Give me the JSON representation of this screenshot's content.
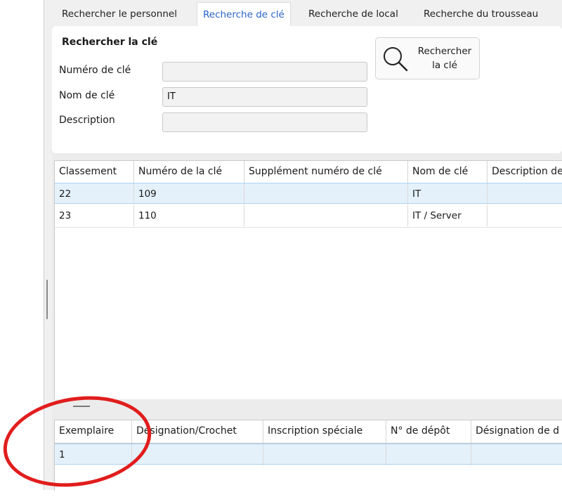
{
  "tabs": [
    {
      "label": "Rechercher le personnel",
      "active": false
    },
    {
      "label": "Recherche de clé",
      "active": true
    },
    {
      "label": "Recherche de local",
      "active": false
    },
    {
      "label": "Recherche du trousseau",
      "active": false
    }
  ],
  "search": {
    "title": "Rechercher la clé",
    "fields": [
      {
        "label": "Numéro de clé",
        "value": ""
      },
      {
        "label": "Nom de clé",
        "value": "IT"
      },
      {
        "label": "Description",
        "value": ""
      }
    ],
    "button_label": "Rechercher\nla clé",
    "button_icon": "search-icon"
  },
  "keys_table": {
    "columns": [
      "Classement",
      "Numéro de la clé",
      "Supplément numéro de clé",
      "Nom de clé",
      "Description de"
    ],
    "rows": [
      [
        "22",
        "109",
        "",
        "IT",
        ""
      ],
      [
        "23",
        "110",
        "",
        "IT / Server",
        ""
      ]
    ],
    "selected_row": 0
  },
  "copies_table": {
    "columns": [
      "Exemplaire",
      "Désignation/Crochet",
      "Inscription spéciale",
      "N° de dépôt",
      "Désignation de d"
    ],
    "rows": [
      [
        "1",
        "",
        "",
        "",
        ""
      ]
    ],
    "selected_row": 0
  },
  "colors": {
    "accent": "#2a63c8",
    "selection": "#e4f1fb",
    "annotation": "#e11d1d"
  }
}
